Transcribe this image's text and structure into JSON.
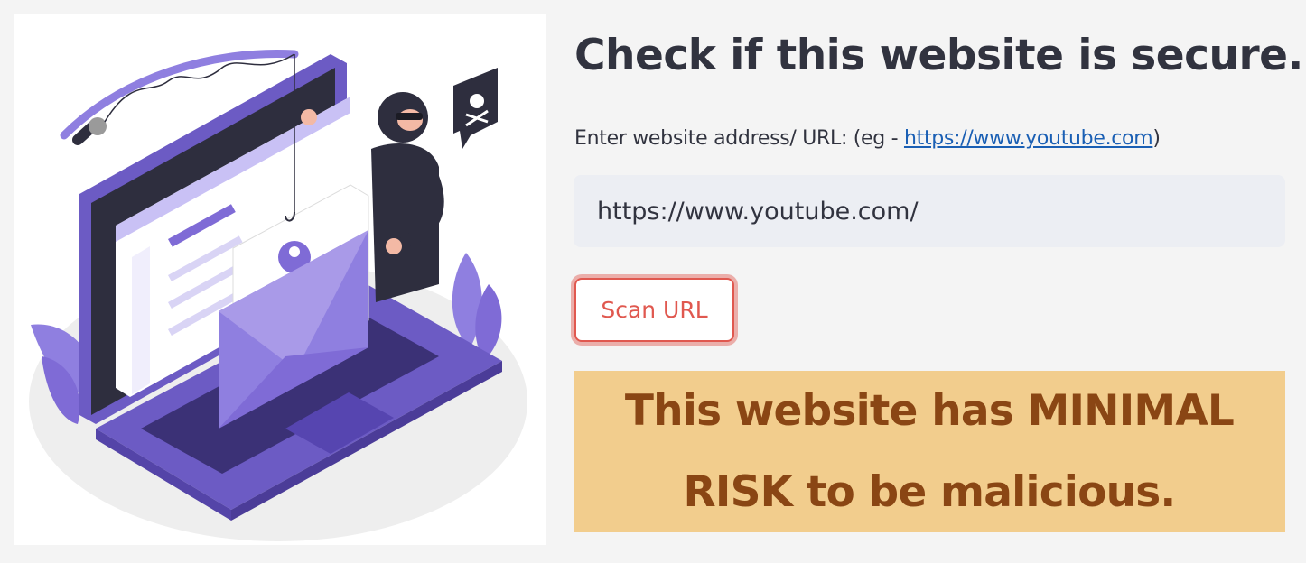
{
  "illustration": {
    "description_icon": "phishing-illustration"
  },
  "header": {
    "title": "Check if this website is secure."
  },
  "form": {
    "label_prefix": "Enter website address/ URL: (eg - ",
    "example_link": "https://www.youtube.com",
    "label_suffix": ")",
    "url_value": "https://www.youtube.com/",
    "scan_button_label": "Scan URL"
  },
  "result": {
    "message": "This website has MINIMAL RISK to be malicious."
  },
  "colors": {
    "accent": "#e0584f",
    "result_background": "#f2cd8d",
    "result_text": "#8a4614",
    "illustration_purple": "#7f6bd6",
    "link": "#1a5fb4"
  }
}
